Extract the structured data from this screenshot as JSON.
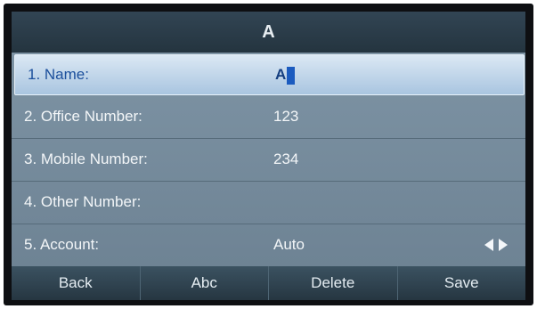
{
  "screen": {
    "title": "A",
    "fields": [
      {
        "label": "1. Name:",
        "value": "A"
      },
      {
        "label": "2. Office Number:",
        "value": "123"
      },
      {
        "label": "3. Mobile Number:",
        "value": "234"
      },
      {
        "label": "4. Other Number:",
        "value": ""
      },
      {
        "label": "5. Account:",
        "value": "Auto"
      }
    ],
    "softkeys": {
      "back": "Back",
      "abc": "Abc",
      "delete": "Delete",
      "save": "Save"
    }
  },
  "colors": {
    "title_bar": "#2c3e4b",
    "list_bg": "#7489a0",
    "selected_row": "#c3d7ea",
    "selected_text": "#1b4f9c",
    "softkey_bar": "#314754"
  }
}
